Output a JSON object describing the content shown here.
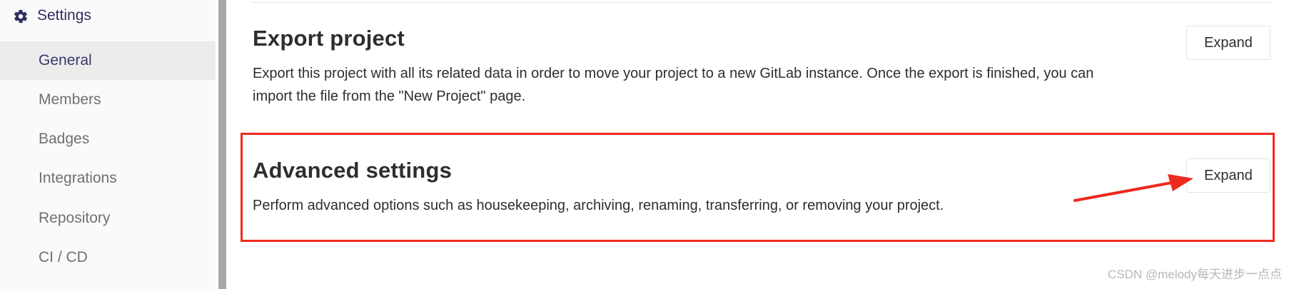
{
  "sidebar": {
    "section": {
      "label": "Settings",
      "icon": "gear-icon"
    },
    "items": [
      {
        "label": "General",
        "active": true
      },
      {
        "label": "Members"
      },
      {
        "label": "Badges"
      },
      {
        "label": "Integrations"
      },
      {
        "label": "Repository"
      },
      {
        "label": "CI / CD"
      }
    ]
  },
  "main": {
    "export": {
      "title": "Export project",
      "description_line1": "Export this project with all its related data in order to move your project to a new GitLab instance. Once the export is finished, you can",
      "description_line2": "import the file from the \"New Project\" page.",
      "button": "Expand"
    },
    "advanced": {
      "title": "Advanced settings",
      "description": "Perform advanced options such as housekeeping, archiving, renaming, transferring, or removing your project.",
      "button": "Expand"
    }
  },
  "annotations": {
    "highlight_color": "#ee2a1e",
    "watermark": "CSDN @melody每天进步一点点"
  },
  "colors": {
    "sidebar_section": "#2e2e60",
    "sidebar_text": "#707070",
    "sidebar_active_bg": "#ececec"
  }
}
